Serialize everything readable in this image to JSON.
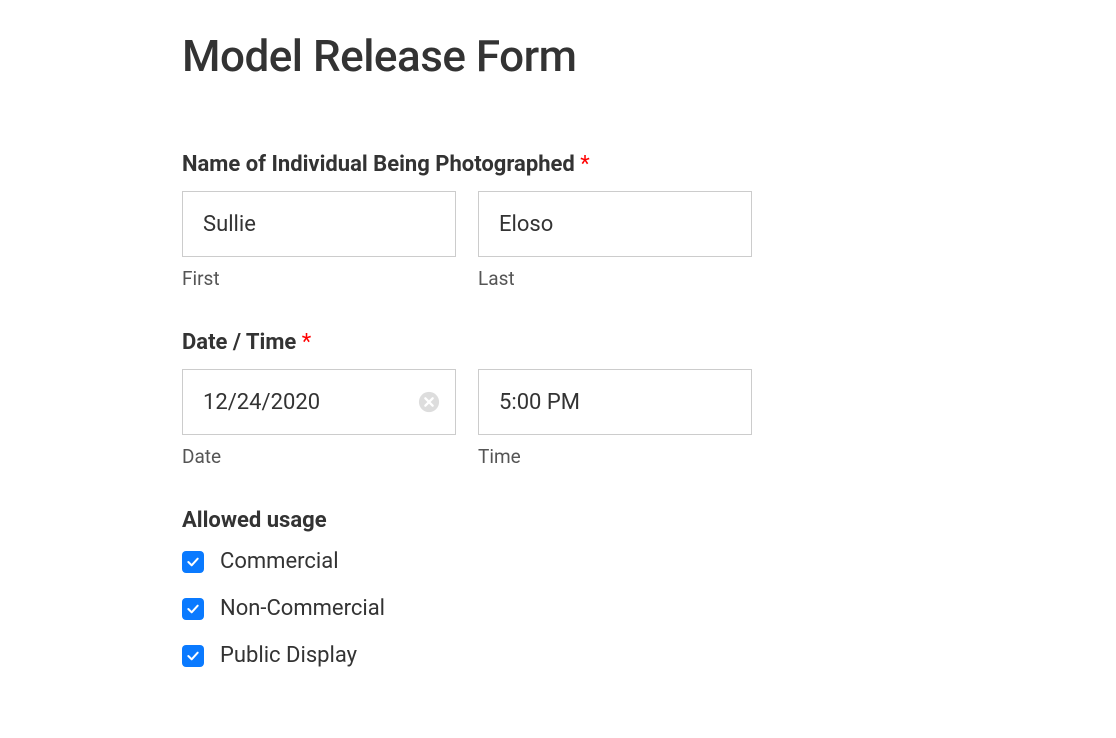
{
  "form": {
    "title": "Model Release Form"
  },
  "name_field": {
    "label": "Name of Individual Being Photographed",
    "required": "*",
    "first": {
      "value": "Sullie",
      "sublabel": "First"
    },
    "last": {
      "value": "Eloso",
      "sublabel": "Last"
    }
  },
  "datetime_field": {
    "label": "Date / Time",
    "required": "*",
    "date": {
      "value": "12/24/2020",
      "sublabel": "Date"
    },
    "time": {
      "value": "5:00 PM",
      "sublabel": "Time"
    }
  },
  "usage_field": {
    "label": "Allowed usage",
    "options": {
      "commercial": "Commercial",
      "non_commercial": "Non-Commercial",
      "public_display": "Public Display"
    }
  }
}
